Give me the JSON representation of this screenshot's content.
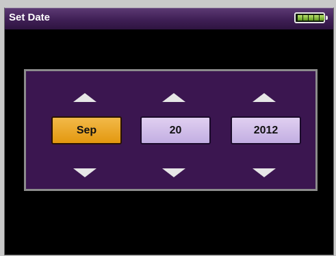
{
  "header": {
    "title": "Set Date",
    "battery": {
      "level_segments": 5,
      "max_segments": 5,
      "fill_color": "#8cc63f"
    }
  },
  "date_picker": {
    "month": {
      "value": "Sep",
      "selected": true
    },
    "day": {
      "value": "20",
      "selected": false
    },
    "year": {
      "value": "2012",
      "selected": false
    }
  },
  "colors": {
    "title_bar": "#3f1f55",
    "panel_background": "#3b1650",
    "selected_field": "#e9a82a",
    "unselected_field": "#cdb9e8"
  },
  "icons": {
    "up": "chevron-up-icon",
    "down": "chevron-down-icon",
    "battery": "battery-icon"
  }
}
